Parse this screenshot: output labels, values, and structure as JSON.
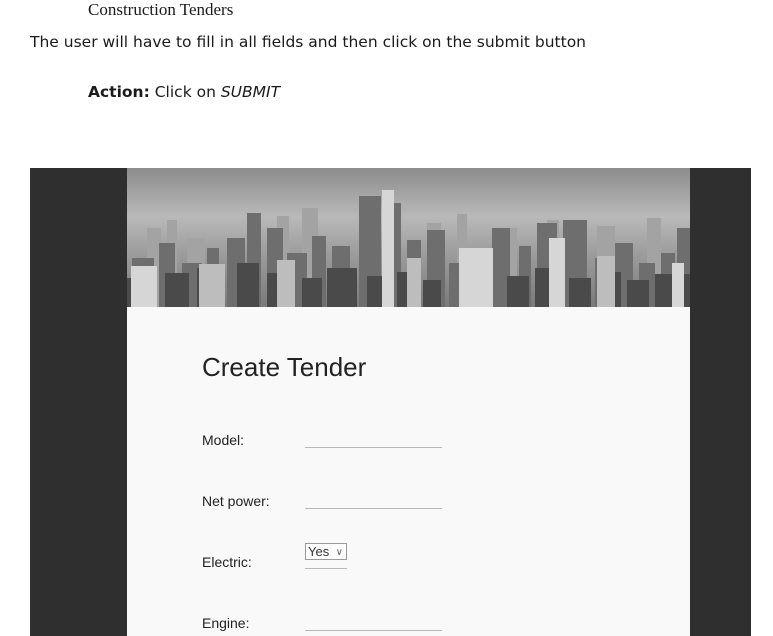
{
  "document": {
    "heading": "Construction Tenders",
    "instruction": "The user will have to fill in all fields and then click on the submit button",
    "action_label": "Action:",
    "action_text": "Click on",
    "action_target": "SUBMIT"
  },
  "app": {
    "form_title": "Create Tender",
    "fields": [
      {
        "label": "Model:",
        "value": ""
      },
      {
        "label": "Net power:",
        "value": ""
      },
      {
        "label": "Electric:",
        "value": "Yes",
        "options": [
          "Yes"
        ]
      },
      {
        "label": "Engine:",
        "value": ""
      }
    ]
  },
  "colors": {
    "frame_background": "#2f2f2f",
    "page_background": "#f9f9f9"
  }
}
